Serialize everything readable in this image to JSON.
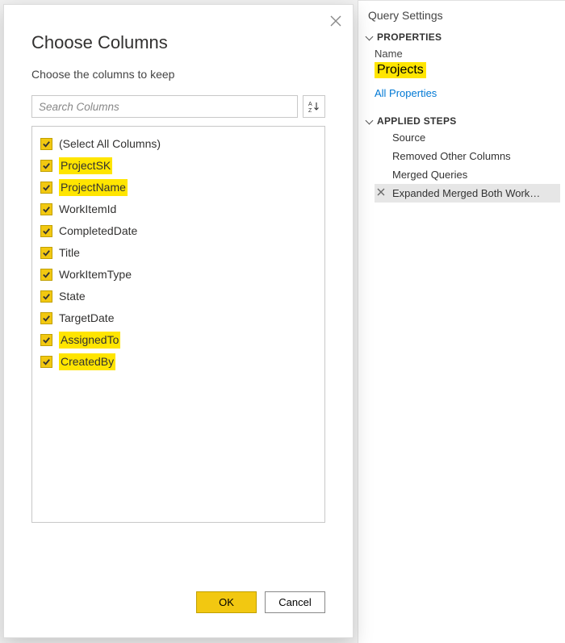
{
  "dialog": {
    "title": "Choose Columns",
    "subtitle": "Choose the columns to keep",
    "search_placeholder": "Search Columns",
    "sort_icon": "sort-az-icon",
    "columns": [
      {
        "label": "(Select All Columns)",
        "checked": true,
        "highlight": false
      },
      {
        "label": "ProjectSK",
        "checked": true,
        "highlight": true
      },
      {
        "label": "ProjectName",
        "checked": true,
        "highlight": true
      },
      {
        "label": "WorkItemId",
        "checked": true,
        "highlight": false
      },
      {
        "label": "CompletedDate",
        "checked": true,
        "highlight": false
      },
      {
        "label": "Title",
        "checked": true,
        "highlight": false
      },
      {
        "label": "WorkItemType",
        "checked": true,
        "highlight": false
      },
      {
        "label": "State",
        "checked": true,
        "highlight": false
      },
      {
        "label": "TargetDate",
        "checked": true,
        "highlight": false
      },
      {
        "label": "AssignedTo",
        "checked": true,
        "highlight": true
      },
      {
        "label": "CreatedBy",
        "checked": true,
        "highlight": true
      }
    ],
    "ok_label": "OK",
    "cancel_label": "Cancel"
  },
  "settings": {
    "panel_title": "Query Settings",
    "properties_header": "PROPERTIES",
    "name_label": "Name",
    "name_value": "Projects",
    "all_properties": "All Properties",
    "steps_header": "APPLIED STEPS",
    "steps": [
      {
        "label": "Source",
        "selected": false
      },
      {
        "label": "Removed Other Columns",
        "selected": false
      },
      {
        "label": "Merged Queries",
        "selected": false
      },
      {
        "label": "Expanded Merged Both Work…",
        "selected": true
      }
    ]
  }
}
